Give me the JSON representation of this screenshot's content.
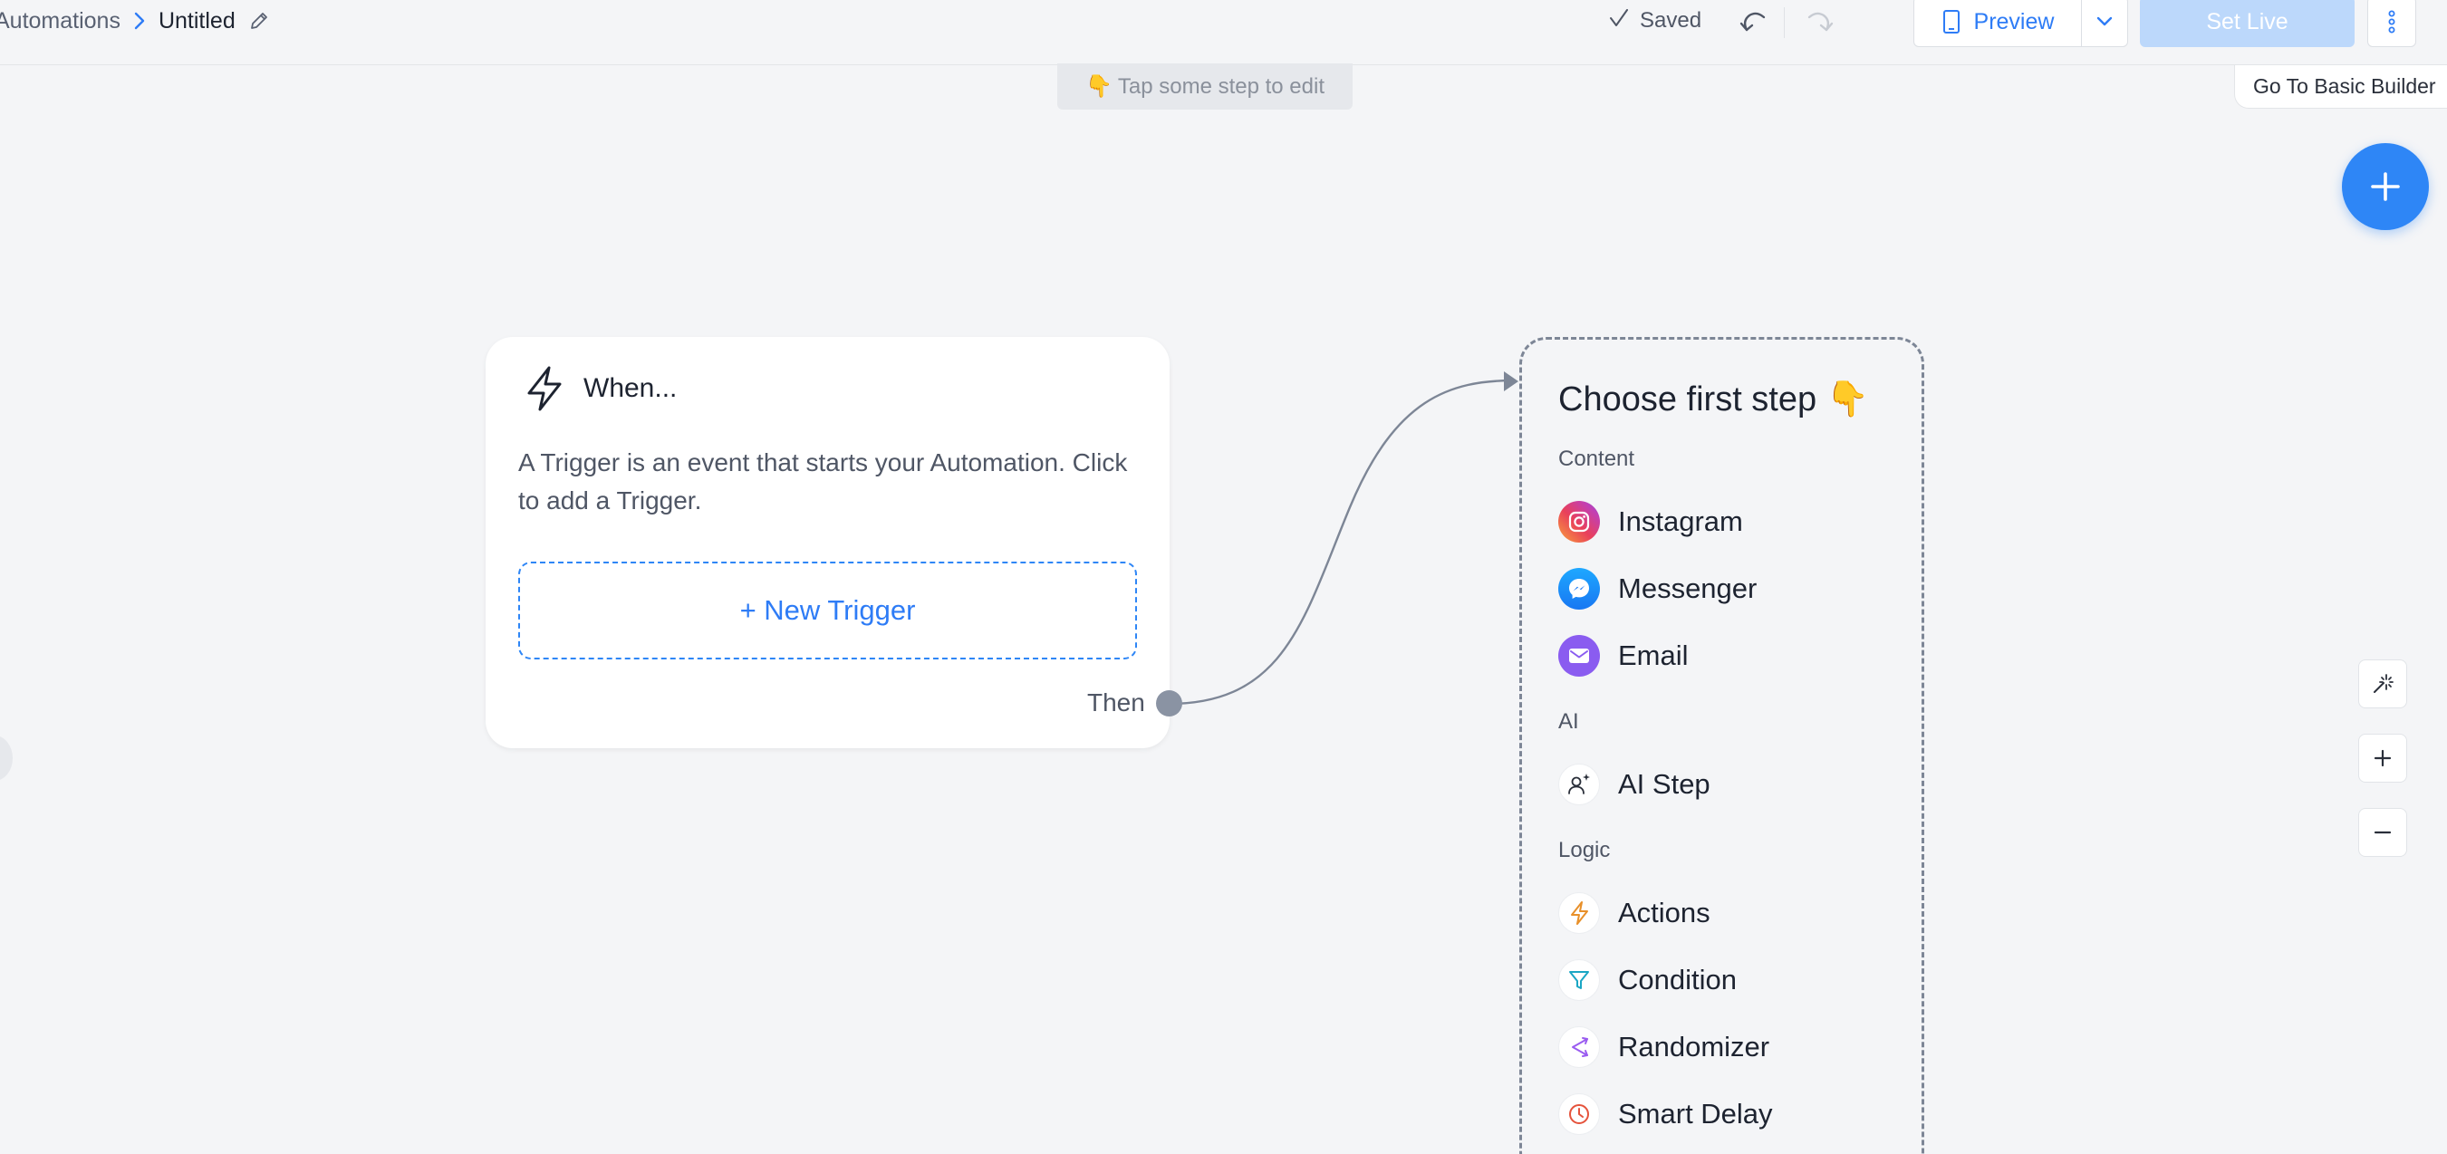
{
  "breadcrumb": {
    "root": "Automations",
    "current": "Untitled"
  },
  "toolbar": {
    "saved_label": "Saved",
    "preview_label": "Preview",
    "set_live_label": "Set Live"
  },
  "hint": {
    "emoji": "👇",
    "text": "Tap some step to edit"
  },
  "basic_builder_label": "Go To Basic Builder",
  "trigger_card": {
    "title": "When...",
    "description": "A Trigger is an event that starts your Automation. Click to add a Trigger.",
    "new_trigger_label": "+ New Trigger",
    "then_label": "Then"
  },
  "step_panel": {
    "title": "Choose first step 👇",
    "groups": [
      {
        "label": "Content",
        "items": [
          {
            "label": "Instagram",
            "icon": "instagram-icon"
          },
          {
            "label": "Messenger",
            "icon": "messenger-icon"
          },
          {
            "label": "Email",
            "icon": "email-icon"
          }
        ]
      },
      {
        "label": "AI",
        "items": [
          {
            "label": "AI Step",
            "icon": "ai-person-icon"
          }
        ]
      },
      {
        "label": "Logic",
        "items": [
          {
            "label": "Actions",
            "icon": "bolt-icon"
          },
          {
            "label": "Condition",
            "icon": "filter-icon"
          },
          {
            "label": "Randomizer",
            "icon": "shuffle-icon"
          },
          {
            "label": "Smart Delay",
            "icon": "clock-icon"
          }
        ]
      }
    ]
  },
  "colors": {
    "accent": "#2e86f6",
    "background": "#f4f5f7",
    "set_live_disabled": "#bcd8fb",
    "connector": "#7d8696"
  }
}
